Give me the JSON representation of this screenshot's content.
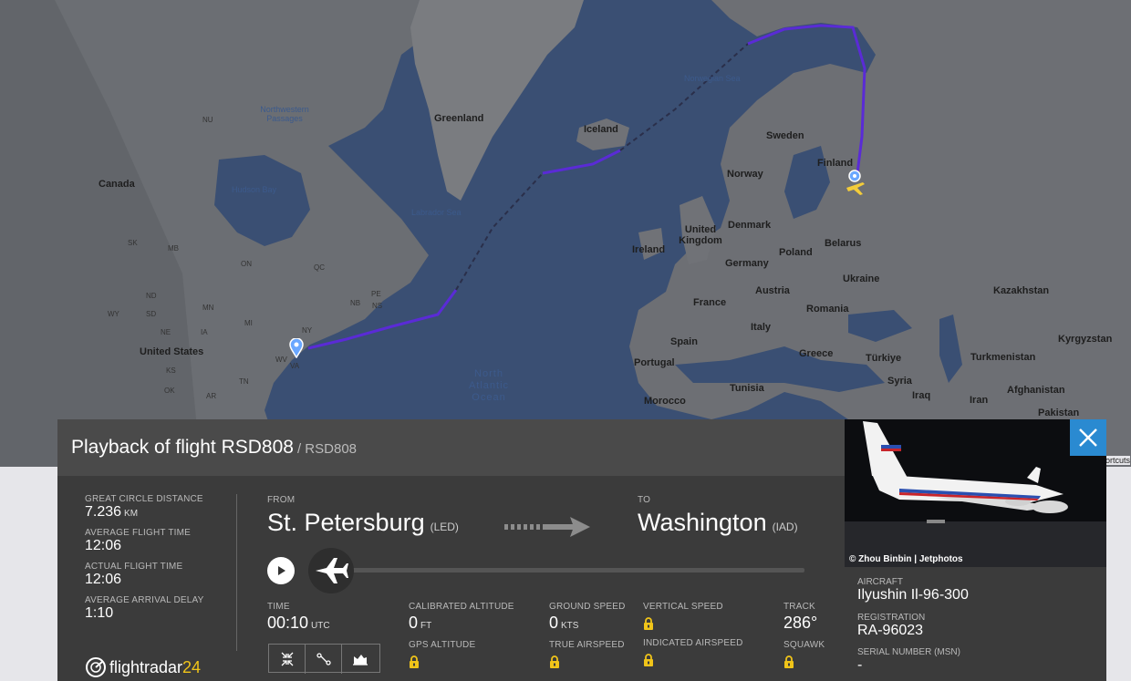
{
  "map": {
    "labels": {
      "greenland": "Greenland",
      "iceland": "Iceland",
      "norwegian_sea": "Norwegian Sea",
      "northwestern_passages": "Northwestern Passages",
      "canada": "Canada",
      "hudson_bay": "Hudson Bay",
      "labrador_sea": "Labrador Sea",
      "united_states": "United States",
      "north_atlantic_ocean": "North Atlantic Ocean",
      "sweden": "Sweden",
      "finland": "Finland",
      "norway": "Norway",
      "united_kingdom": "United Kingdom",
      "ireland": "Ireland",
      "denmark": "Denmark",
      "belarus": "Belarus",
      "poland": "Poland",
      "germany": "Germany",
      "ukraine": "Ukraine",
      "france": "France",
      "austria": "Austria",
      "romania": "Romania",
      "kazakhstan": "Kazakhstan",
      "spain": "Spain",
      "italy": "Italy",
      "portugal": "Portugal",
      "greece": "Greece",
      "turkiye": "Türkiye",
      "kyrgyzstan": "Kyrgyzstan",
      "turkmenistan": "Turkmenistan",
      "morocco": "Morocco",
      "tunisia": "Tunisia",
      "syria": "Syria",
      "iraq": "Iraq",
      "iran": "Iran",
      "afghanistan": "Afghanistan",
      "pakistan": "Pakistan",
      "nu": "NU",
      "qc": "QC",
      "nb": "NB",
      "ns": "NS",
      "ny": "NY",
      "va": "VA",
      "mn": "MN",
      "mi": "MI",
      "sk": "SK",
      "mb": "MB",
      "on": "ON",
      "ia": "IA",
      "ks": "KS",
      "ok": "OK",
      "ar": "AR",
      "wy": "WY",
      "nd": "ND",
      "sd": "SD",
      "ne": "NE",
      "tn": "TN",
      "wv": "WV",
      "pe": "PE",
      "shortcuts": "ortcuts"
    }
  },
  "panel": {
    "title": "Playback of flight RSD808",
    "title_sub": "/ RSD808",
    "stats": [
      {
        "label": "GREAT CIRCLE DISTANCE",
        "value": "7.236",
        "unit": "KM"
      },
      {
        "label": "AVERAGE FLIGHT TIME",
        "value": "12:06",
        "unit": ""
      },
      {
        "label": "ACTUAL FLIGHT TIME",
        "value": "12:06",
        "unit": ""
      },
      {
        "label": "AVERAGE ARRIVAL DELAY",
        "value": "1:10",
        "unit": ""
      }
    ],
    "logo_text": "flightradar",
    "logo_num": "24",
    "from_label": "FROM",
    "from_city": "St. Petersburg",
    "from_code": "(LED)",
    "to_label": "TO",
    "to_city": "Washington",
    "to_code": "(IAD)",
    "playback_progress": 0.0,
    "time_label": "TIME",
    "time_value": "00:10",
    "time_unit": "UTC",
    "cal_alt_label": "CALIBRATED ALTITUDE",
    "cal_alt_value": "0",
    "cal_alt_unit": "FT",
    "gps_alt_label": "GPS ALTITUDE",
    "ground_speed_label": "GROUND SPEED",
    "ground_speed_value": "0",
    "ground_speed_unit": "KTS",
    "true_airspeed_label": "TRUE AIRSPEED",
    "vertical_speed_label": "VERTICAL SPEED",
    "indicated_airspeed_label": "INDICATED AIRSPEED",
    "track_label": "TRACK",
    "track_value": "286°",
    "squawk_label": "SQUAWK"
  },
  "photo_pane": {
    "credit": "© Zhou Binbin | Jetphotos",
    "aircraft_label": "AIRCRAFT",
    "aircraft_value": "Ilyushin Il-96-300",
    "registration_label": "REGISTRATION",
    "registration_value": "RA-96023",
    "serial_label": "SERIAL NUMBER (MSN)",
    "serial_value": "-"
  },
  "colors": {
    "track_solid": "#5a2bd6",
    "panel_bg": "#3b3b3b",
    "header_bg": "#4a4a4a",
    "close_bg": "#2a8ad1",
    "lock": "#f0c419"
  }
}
